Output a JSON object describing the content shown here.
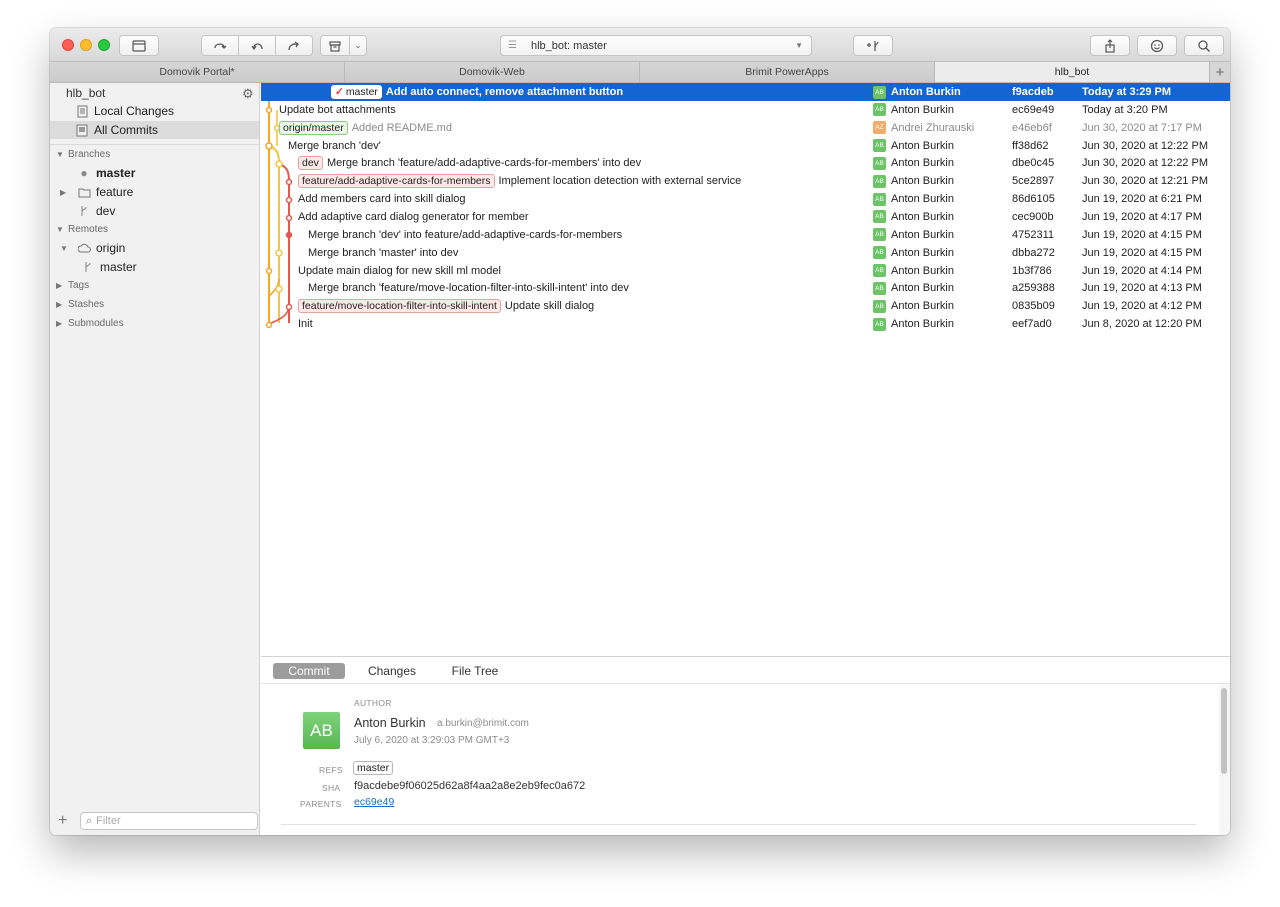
{
  "toolbar": {
    "branch_selector": "hlb_bot: master"
  },
  "tabs": [
    "Domovik Portal*",
    "Domovik-Web",
    "Brimit PowerApps",
    "hlb_bot"
  ],
  "sidebar": {
    "repo": "hlb_bot",
    "views": [
      "Local Changes",
      "All Commits"
    ],
    "sections": {
      "branches": "Branches",
      "remotes": "Remotes",
      "tags": "Tags",
      "stashes": "Stashes",
      "submodules": "Submodules"
    },
    "branches": [
      "master",
      "feature",
      "dev"
    ],
    "remote_name": "origin",
    "remote_branch": "master",
    "filter_placeholder": "Filter"
  },
  "commits": [
    {
      "refs": [
        {
          "name": "master",
          "kind": "current"
        }
      ],
      "message": "Add auto connect, remove attachment button",
      "initials": "AB",
      "author": "Anton Burkin",
      "sha": "f9acdeb",
      "date": "Today at 3:29 PM"
    },
    {
      "refs": [],
      "message": "Update bot attachments",
      "initials": "AB",
      "author": "Anton Burkin",
      "sha": "ec69e49",
      "date": "Today at 3:20 PM"
    },
    {
      "refs": [
        {
          "name": "origin/master",
          "kind": "remote"
        }
      ],
      "message": "Added README.md",
      "initials": "AZ",
      "author": "Andrei Zhurauski",
      "sha": "e46eb6f",
      "date": "Jun 30, 2020 at 7:17 PM"
    },
    {
      "refs": [],
      "message": "Merge branch 'dev'",
      "initials": "AB",
      "author": "Anton Burkin",
      "sha": "ff38d62",
      "date": "Jun 30, 2020 at 12:22 PM"
    },
    {
      "refs": [
        {
          "name": "dev",
          "kind": "feature"
        }
      ],
      "message": "Merge branch 'feature/add-adaptive-cards-for-members' into dev",
      "initials": "AB",
      "author": "Anton Burkin",
      "sha": "dbe0c45",
      "date": "Jun 30, 2020 at 12:22 PM"
    },
    {
      "refs": [
        {
          "name": "feature/add-adaptive-cards-for-members",
          "kind": "feature"
        }
      ],
      "message": "Implement location detection with external service",
      "initials": "AB",
      "author": "Anton Burkin",
      "sha": "5ce2897",
      "date": "Jun 30, 2020 at 12:21 PM"
    },
    {
      "refs": [],
      "message": "Add members card into skill dialog",
      "initials": "AB",
      "author": "Anton Burkin",
      "sha": "86d6105",
      "date": "Jun 19, 2020 at 6:21 PM"
    },
    {
      "refs": [],
      "message": "Add adaptive card dialog generator for member",
      "initials": "AB",
      "author": "Anton Burkin",
      "sha": "cec900b",
      "date": "Jun 19, 2020 at 4:17 PM"
    },
    {
      "refs": [],
      "message": "Merge branch 'dev' into feature/add-adaptive-cards-for-members",
      "initials": "AB",
      "author": "Anton Burkin",
      "sha": "4752311",
      "date": "Jun 19, 2020 at 4:15 PM"
    },
    {
      "refs": [],
      "message": "Merge branch 'master' into dev",
      "initials": "AB",
      "author": "Anton Burkin",
      "sha": "dbba272",
      "date": "Jun 19, 2020 at 4:15 PM"
    },
    {
      "refs": [],
      "message": "Update main dialog for new skill ml model",
      "initials": "AB",
      "author": "Anton Burkin",
      "sha": "1b3f786",
      "date": "Jun 19, 2020 at 4:14 PM"
    },
    {
      "refs": [],
      "message": "Merge branch 'feature/move-location-filter-into-skill-intent' into dev",
      "initials": "AB",
      "author": "Anton Burkin",
      "sha": "a259388",
      "date": "Jun 19, 2020 at 4:13 PM"
    },
    {
      "refs": [
        {
          "name": "feature/move-location-filter-into-skill-intent",
          "kind": "feature"
        }
      ],
      "message": "Update skill dialog",
      "initials": "AB",
      "author": "Anton Burkin",
      "sha": "0835b09",
      "date": "Jun 19, 2020 at 4:12 PM"
    },
    {
      "refs": [],
      "message": "Init",
      "initials": "AB",
      "author": "Anton Burkin",
      "sha": "eef7ad0",
      "date": "Jun 8, 2020 at 12:20 PM"
    }
  ],
  "detail_tabs": [
    "Commit",
    "Changes",
    "File Tree"
  ],
  "details": {
    "author_label": "AUTHOR",
    "initials": "AB",
    "author_name": "Anton Burkin",
    "author_email": "a.burkin@brimit.com",
    "date": "July 6, 2020 at 3:29:03 PM GMT+3",
    "refs_label": "REFS",
    "refs_value": "master",
    "sha_label": "SHA",
    "sha_value": "f9acdebe9f06025d62a8f4aa2a8e2eb9fec0a672",
    "parents_label": "PARENTS",
    "parents_value": "ec69e49"
  },
  "colors": {
    "selection": "#1464d2",
    "graph_orange": "#f5a623",
    "graph_yellow": "#f4c542",
    "graph_red": "#e05a4f",
    "avatar_green": "#6cc467",
    "avatar_orange": "#f0ad6b"
  }
}
